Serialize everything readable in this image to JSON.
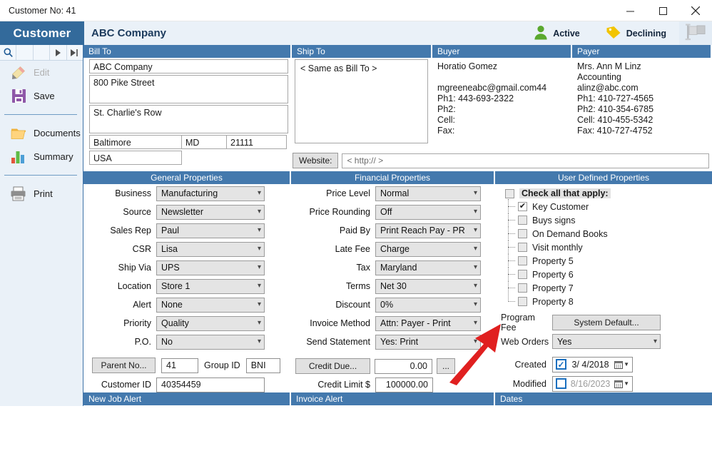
{
  "window": {
    "title": "Customer No: 41",
    "minimize": "—",
    "maximize": "□",
    "close": "✕"
  },
  "header": {
    "app_tag": "Customer",
    "company": "ABC Company",
    "status_active": "Active",
    "status_declining": "Declining",
    "accent_blue": "#4479ad",
    "tag_dark_blue": "#336a9b",
    "active_green": "#5aa82e",
    "declining_yellow": "#f2c400"
  },
  "toolbar": {
    "search": "search-icon",
    "blank1": "",
    "blank2": "",
    "next": "▶",
    "last": "▶|"
  },
  "sidebar": {
    "items": [
      {
        "label": "Edit",
        "icon": "pencil-icon",
        "disabled": true
      },
      {
        "label": "Save",
        "icon": "floppy-disk-icon",
        "disabled": false
      },
      {
        "label": "Documents",
        "icon": "folder-icon",
        "disabled": false
      },
      {
        "label": "Summary",
        "icon": "bar-chart-icon",
        "disabled": false
      },
      {
        "label": "Print",
        "icon": "printer-icon",
        "disabled": false
      }
    ]
  },
  "bill_to": {
    "header": "Bill To",
    "company": "ABC Company",
    "address1": "800 Pike Street",
    "address2": "St. Charlie's Row",
    "city": "Baltimore",
    "state": "MD",
    "zip": "21111",
    "country": "USA"
  },
  "ship_to": {
    "header": "Ship To",
    "text": "< Same as Bill To >"
  },
  "buyer": {
    "header": "Buyer",
    "name": "Horatio Gomez",
    "line2": "",
    "email": "mgreeneabc@gmail.com44",
    "ph1": "Ph1: 443-693-2322",
    "ph2": "Ph2:",
    "cell": "Cell:",
    "fax": "Fax:"
  },
  "payer": {
    "header": "Payer",
    "name": "Mrs. Ann M Linz",
    "line2": "Accounting",
    "email": "alinz@abc.com",
    "ph1": "Ph1: 410-727-4565",
    "ph2": "Ph2: 410-354-6785",
    "cell": "Cell: 410-455-5342",
    "fax": "Fax: 410-727-4752"
  },
  "website": {
    "button": "Website:",
    "placeholder": "< http:// >",
    "value": "< http:// >"
  },
  "general": {
    "header": "General Properties",
    "fields": [
      {
        "label": "Business",
        "value": "Manufacturing"
      },
      {
        "label": "Source",
        "value": "Newsletter"
      },
      {
        "label": "Sales Rep",
        "value": "Paul"
      },
      {
        "label": "CSR",
        "value": "Lisa"
      },
      {
        "label": "Ship Via",
        "value": "UPS"
      },
      {
        "label": "Location",
        "value": "Store 1"
      },
      {
        "label": "Alert",
        "value": "None"
      },
      {
        "label": "Priority",
        "value": "Quality"
      },
      {
        "label": "P.O.",
        "value": "No"
      }
    ],
    "parent_button": "Parent No...",
    "parent_value": "41",
    "group_id_label": "Group ID",
    "group_id_value": "BNI",
    "customer_id_label": "Customer ID",
    "customer_id_value": "40354459"
  },
  "financial": {
    "header": "Financial Properties",
    "fields": [
      {
        "label": "Price Level",
        "value": "Normal"
      },
      {
        "label": "Price Rounding",
        "value": "Off"
      },
      {
        "label": "Paid By",
        "value": "Print Reach Pay - PR"
      },
      {
        "label": "Late Fee",
        "value": "Charge"
      },
      {
        "label": "Tax",
        "value": "Maryland"
      },
      {
        "label": "Terms",
        "value": "Net 30"
      },
      {
        "label": "Discount",
        "value": "0%"
      },
      {
        "label": "Invoice Method",
        "value": "Attn: Payer - Print"
      },
      {
        "label": "Send Statement",
        "value": "Yes: Print"
      }
    ],
    "credit_due_button": "Credit Due...",
    "credit_due_value": "0.00",
    "ellipsis_button": "...",
    "credit_limit_label": "Credit Limit $",
    "credit_limit_value": "100000.00"
  },
  "user_defined": {
    "header": "User Defined Properties",
    "check_all_label": "Check all that apply:",
    "properties": [
      {
        "label": "Key Customer",
        "checked": true
      },
      {
        "label": "Buys signs",
        "checked": false
      },
      {
        "label": "On Demand Books",
        "checked": false
      },
      {
        "label": "Visit monthly",
        "checked": false
      },
      {
        "label": "Property 5",
        "checked": false
      },
      {
        "label": "Property 6",
        "checked": false
      },
      {
        "label": "Property 7",
        "checked": false
      },
      {
        "label": "Property 8",
        "checked": false
      }
    ],
    "program_fee_label": "Program Fee",
    "program_fee_button": "System Default...",
    "web_orders_label": "Web Orders",
    "web_orders_value": "Yes",
    "created_label": "Created",
    "created_value": "3/ 4/2018",
    "created_checked": true,
    "modified_label": "Modified",
    "modified_value": "8/16/2023",
    "modified_checked": false
  },
  "bottom": {
    "new_job_alert": "New Job Alert",
    "invoice_alert": "Invoice Alert",
    "dates": "Dates"
  },
  "annotation": {
    "arrow_color": "#e02020",
    "points_to": "Program Fee"
  }
}
